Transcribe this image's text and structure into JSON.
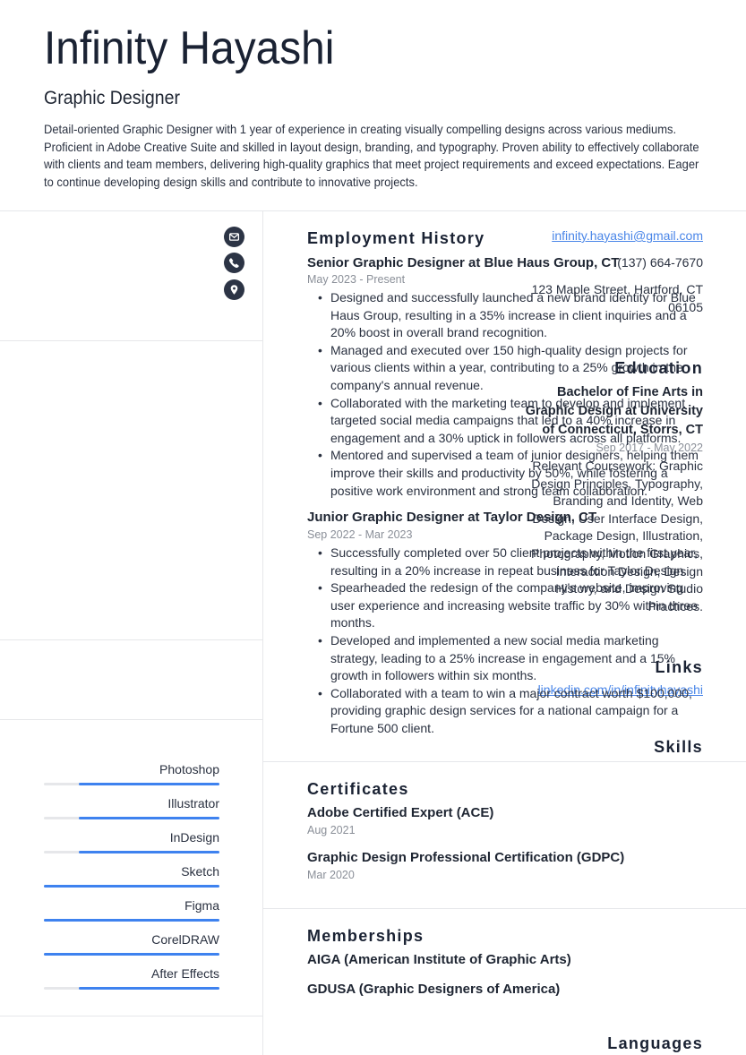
{
  "header": {
    "name": "Infinity Hayashi",
    "title": "Graphic Designer",
    "summary": "Detail-oriented Graphic Designer with 1 year of experience in creating visually compelling designs across various mediums. Proficient in Adobe Creative Suite and skilled in layout design, branding, and typography. Proven ability to effectively collaborate with clients and team members, delivering high-quality graphics that meet project requirements and exceed expectations. Eager to continue developing design skills and contribute to innovative projects."
  },
  "contact": {
    "email": "infinity.hayashi@gmail.com",
    "phone": "(137) 664-7670",
    "address": "123 Maple Street, Hartford, CT 06105",
    "icons": [
      "envelope-icon",
      "phone-icon",
      "location-pin-icon"
    ]
  },
  "education": {
    "heading": "Education",
    "degree": "Bachelor of Fine Arts in Graphic Design at University of Connecticut, Storrs, CT",
    "dates": "Sep 2017 - May 2022",
    "description": "Relevant Coursework: Graphic Design Principles, Typography, Branding and Identity, Web Design, User Interface Design, Package Design, Illustration, Photography, Motion Graphics, Interaction Design, Design History, and Design Studio Practices."
  },
  "links": {
    "heading": "Links",
    "items": [
      "linkedin.com/in/infinityhayashi"
    ]
  },
  "skills": {
    "heading": "Skills",
    "accent_color": "#3e82ef",
    "track_color": "#e6e7ea",
    "items": [
      {
        "name": "Photoshop",
        "level": 0.8
      },
      {
        "name": "Illustrator",
        "level": 0.8
      },
      {
        "name": "InDesign",
        "level": 0.8
      },
      {
        "name": "Sketch",
        "level": 1.0
      },
      {
        "name": "Figma",
        "level": 1.0
      },
      {
        "name": "CorelDRAW",
        "level": 1.0
      },
      {
        "name": "After Effects",
        "level": 0.8
      }
    ]
  },
  "languages": {
    "heading": "Languages"
  },
  "employment": {
    "heading": "Employment History",
    "jobs": [
      {
        "title": "Senior Graphic Designer at Blue Haus Group, CT",
        "dates": "May 2023 - Present",
        "bullets": [
          "Designed and successfully launched a new brand identity for Blue Haus Group, resulting in a 35% increase in client inquiries and a 20% boost in overall brand recognition.",
          "Managed and executed over 150 high-quality design projects for various clients within a year, contributing to a 25% growth in the company's annual revenue.",
          "Collaborated with the marketing team to develop and implement targeted social media campaigns that led to a 40% increase in engagement and a 30% uptick in followers across all platforms.",
          "Mentored and supervised a team of junior designers, helping them improve their skills and productivity by 50%, while fostering a positive work environment and strong team collaboration."
        ]
      },
      {
        "title": "Junior Graphic Designer at Taylor Design, CT",
        "dates": "Sep 2022 - Mar 2023",
        "bullets": [
          "Successfully completed over 50 client projects within the first year, resulting in a 20% increase in repeat business for Taylor Design.",
          "Spearheaded the redesign of the company's website, improving user experience and increasing website traffic by 30% within three months.",
          "Developed and implemented a new social media marketing strategy, leading to a 25% increase in engagement and a 15% growth in followers within six months.",
          "Collaborated with a team to win a major contract worth $100,000, providing graphic design services for a national campaign for a Fortune 500 client."
        ]
      }
    ]
  },
  "certificates": {
    "heading": "Certificates",
    "items": [
      {
        "name": "Adobe Certified Expert (ACE)",
        "date": "Aug 2021"
      },
      {
        "name": "Graphic Design Professional Certification (GDPC)",
        "date": "Mar 2020"
      }
    ]
  },
  "memberships": {
    "heading": "Memberships",
    "items": [
      "AIGA (American Institute of Graphic Arts)",
      "GDUSA (Graphic Designers of America)"
    ]
  }
}
